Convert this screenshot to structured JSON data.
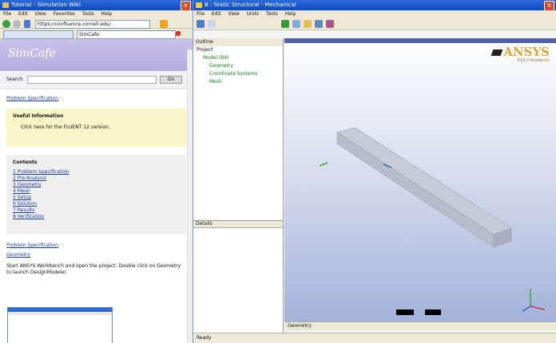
{
  "browser": {
    "title": "Tutorial - Simulation Wiki",
    "menu": [
      "File",
      "Edit",
      "View",
      "Favorites",
      "Tools",
      "Help"
    ],
    "address": "https://confluence.cornell.edu/",
    "search_tab": "SimCafe",
    "site_title": "SimCafe",
    "search_label": "Search",
    "search_button": "Go",
    "breadcrumb_links": "Problem Specification",
    "warning_title": "Useful Information",
    "warning_body": "Click here for the FLUENT 12 version.",
    "toc_title": "Contents",
    "toc_items": [
      "1 Problem Specification",
      "2 Pre-Analysis",
      "3 Geometry",
      "4 Mesh",
      "5 Setup",
      "6 Solution",
      "7 Results",
      "8 Verification"
    ],
    "section1": "Problem Specification",
    "section2": "Geometry",
    "body_text": "Start ANSYS Workbench and open the project. Double click on Geometry to launch DesignModeler."
  },
  "ansys": {
    "title": "B : Static Structural - Mechanical",
    "menu": [
      "File",
      "Edit",
      "View",
      "Units",
      "Tools",
      "Help"
    ],
    "outline_header": "Outline",
    "tree": [
      "Project",
      "Model (B4)",
      "Geometry",
      "Coordinate Systems",
      "Mesh"
    ],
    "details_header": "Details",
    "view_tab": "Geometry",
    "status": "Ready",
    "brand": "ANSYS",
    "brand_sub": "R13.0 Academic"
  }
}
